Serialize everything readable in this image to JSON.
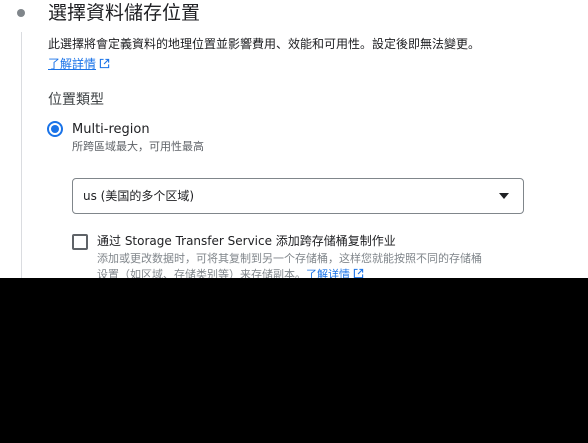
{
  "step": {
    "title": "選擇資料儲存位置",
    "description": "此選擇將會定義資料的地理位置並影響費用、效能和可用性。設定後即無法變更。",
    "learn_more": "了解詳情"
  },
  "location_type": {
    "heading": "位置類型",
    "selected_option": {
      "label": "Multi-region",
      "hint": "所跨區域最大，可用性最高"
    },
    "region_select": {
      "value": "us (美国的多个区域)"
    },
    "replication": {
      "checkbox_label": "通过 Storage Transfer Service 添加跨存储桶复制作业",
      "checked": false,
      "hint_line1": "添加或更改数据时，可将其复制到另一个存储桶，这样您就能按照不同的存储桶",
      "hint_line2": "设置（如区域、存储类别等）来存储副本。",
      "hint_link": "了解详情"
    }
  },
  "colors": {
    "accent": "#1a73e8",
    "text": "#202124",
    "secondary_text": "#5f6368",
    "border": "#80868b",
    "obscured_area": "#000000"
  },
  "icons": {
    "step_marker": "step-dot-icon",
    "external_link": "open-in-new-icon",
    "dropdown": "arrow-drop-down-icon"
  }
}
